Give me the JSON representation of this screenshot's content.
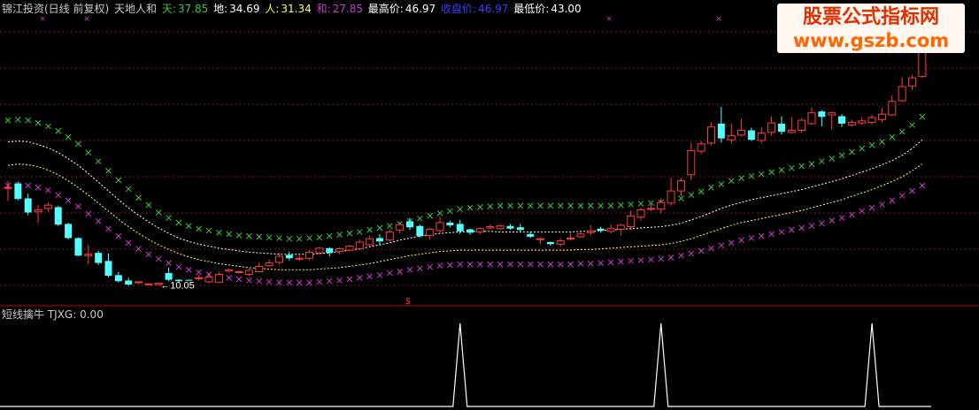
{
  "header": {
    "title": "锦江投资(日线 前复权)",
    "indicator_name": "天地人和",
    "tian_label": "天:",
    "tian_value": "37.85",
    "di_label": "地:",
    "di_value": "34.69",
    "ren_label": "人:",
    "ren_value": "31.34",
    "he_label": "和:",
    "he_value": "27.85",
    "high_label": "最高价:",
    "high_value": "46.97",
    "close_label": "收盘价:",
    "close_value": "46.97",
    "low_label": "最低价:",
    "low_value": "43.00"
  },
  "watermark": {
    "line1": "股票公式指标网",
    "line2": "www.gszb.com"
  },
  "sub_panel": {
    "name": "短线擒牛",
    "label": "TJXG:",
    "value": "0.00"
  },
  "colors": {
    "up": "#ff3c3c",
    "down": "#54ffff",
    "tian": "#3cc83c",
    "he": "#c83cc8",
    "di": "#ffffff",
    "ren": "#ffff64",
    "grid": "#7a1f1f",
    "axis": "#c00000"
  },
  "chart_data": [
    {
      "type": "candlestick",
      "ylim": [
        8,
        50
      ],
      "grid": "dotted horizontal",
      "annotations": [
        {
          "text": "←10.05",
          "index": 15,
          "value": 10.05
        }
      ],
      "candles": [
        [
          24.5,
          24.5,
          25.5,
          22.5
        ],
        [
          25.1,
          22.8,
          25.4,
          22.6
        ],
        [
          22.9,
          20.8,
          23.6,
          20.4
        ],
        [
          20.9,
          21.2,
          21.9,
          19.2
        ],
        [
          21.4,
          21.9,
          22.3,
          20.9
        ],
        [
          21.6,
          19.0,
          21.8,
          18.8
        ],
        [
          19.1,
          17.0,
          19.3,
          16.8
        ],
        [
          17.0,
          14.4,
          17.1,
          14.3
        ],
        [
          14.4,
          14.6,
          16.0,
          13.1
        ],
        [
          14.8,
          13.3,
          15.1,
          13.0
        ],
        [
          13.6,
          11.4,
          14.7,
          11.2
        ],
        [
          11.5,
          10.6,
          12.0,
          10.4
        ],
        [
          10.7,
          10.1,
          11.1,
          9.9
        ],
        [
          10.4,
          10.5,
          10.6,
          10.2
        ],
        [
          10.2,
          10.2,
          10.2,
          10.2
        ],
        [
          10.1,
          10.3,
          10.4,
          10.0
        ],
        [
          11.8,
          10.8,
          12.6,
          10.6
        ],
        [
          10.8,
          10.6,
          10.9,
          10.4
        ],
        [
          10.8,
          10.7,
          10.8,
          10.6
        ],
        [
          11.0,
          11.1,
          11.5,
          10.7
        ],
        [
          10.5,
          11.2,
          11.8,
          10.3
        ],
        [
          10.4,
          11.6,
          12.0,
          10.3
        ],
        [
          12.1,
          12.3,
          12.5,
          11.9
        ],
        [
          12.0,
          12.0,
          12.2,
          11.8
        ],
        [
          11.6,
          12.2,
          12.5,
          11.4
        ],
        [
          12.0,
          12.8,
          13.4,
          11.9
        ],
        [
          12.9,
          13.3,
          13.8,
          12.7
        ],
        [
          13.4,
          14.3,
          14.8,
          13.1
        ],
        [
          14.5,
          14.0,
          15.0,
          13.7
        ],
        [
          13.9,
          14.0,
          14.5,
          13.6
        ],
        [
          14.0,
          14.9,
          15.2,
          13.7
        ],
        [
          14.8,
          15.5,
          15.7,
          14.5
        ],
        [
          15.5,
          14.8,
          15.6,
          14.3
        ],
        [
          15.0,
          15.4,
          15.6,
          14.6
        ],
        [
          15.2,
          15.8,
          16.0,
          15.0
        ],
        [
          15.4,
          16.4,
          16.8,
          15.2
        ],
        [
          16.0,
          16.9,
          17.4,
          15.8
        ],
        [
          17.0,
          16.5,
          17.6,
          15.9
        ],
        [
          16.7,
          17.9,
          18.3,
          16.5
        ],
        [
          18.2,
          19.0,
          19.4,
          17.7
        ],
        [
          19.5,
          18.6,
          20.0,
          18.2
        ],
        [
          18.8,
          17.3,
          19.0,
          17.1
        ],
        [
          17.4,
          18.3,
          18.5,
          16.8
        ],
        [
          18.1,
          19.3,
          20.2,
          17.8
        ],
        [
          19.3,
          18.9,
          19.6,
          18.6
        ],
        [
          19.1,
          18.0,
          19.7,
          17.6
        ],
        [
          18.3,
          17.8,
          18.4,
          17.5
        ],
        [
          17.9,
          18.4,
          18.6,
          17.6
        ],
        [
          18.5,
          18.7,
          19.0,
          18.3
        ],
        [
          18.4,
          18.8,
          19.0,
          18.2
        ],
        [
          18.8,
          18.4,
          19.1,
          18.2
        ],
        [
          18.6,
          18.2,
          19.1,
          17.8
        ],
        [
          17.6,
          17.2,
          18.0,
          17.0
        ],
        [
          16.9,
          16.9,
          17.1,
          16.1
        ],
        [
          16.4,
          16.1,
          16.5,
          15.9
        ],
        [
          16.1,
          16.6,
          17.0,
          15.8
        ],
        [
          17.0,
          17.0,
          17.8,
          16.6
        ],
        [
          17.2,
          17.6,
          17.9,
          17.0
        ],
        [
          17.8,
          18.0,
          18.9,
          17.4
        ],
        [
          18.4,
          18.1,
          18.7,
          17.8
        ],
        [
          18.0,
          18.4,
          19.0,
          17.7
        ],
        [
          18.3,
          18.9,
          19.1,
          17.4
        ],
        [
          18.7,
          20.3,
          21.1,
          18.2
        ],
        [
          20.1,
          21.2,
          21.5,
          19.6
        ],
        [
          21.4,
          21.4,
          22.0,
          21.0
        ],
        [
          21.3,
          22.3,
          22.9,
          20.7
        ],
        [
          22.2,
          24.0,
          26.0,
          21.8
        ],
        [
          24.0,
          25.5,
          25.9,
          23.2
        ],
        [
          26.4,
          30.0,
          31.1,
          25.6
        ],
        [
          29.9,
          31.0,
          31.4,
          29.5
        ],
        [
          31.1,
          33.5,
          34.2,
          30.8
        ],
        [
          34.0,
          31.8,
          36.5,
          31.2
        ],
        [
          31.6,
          32.2,
          34.0,
          31.0
        ],
        [
          32.3,
          33.0,
          34.8,
          32.1
        ],
        [
          33.0,
          31.6,
          33.4,
          31.4
        ],
        [
          31.5,
          32.6,
          33.5,
          31.1
        ],
        [
          32.7,
          34.1,
          35.1,
          32.2
        ],
        [
          34.0,
          32.8,
          35.1,
          32.4
        ],
        [
          32.7,
          33.0,
          35.0,
          32.5
        ],
        [
          33.0,
          34.5,
          34.8,
          32.6
        ],
        [
          34.0,
          35.6,
          36.4,
          33.8
        ],
        [
          35.8,
          35.0,
          36.0,
          33.6
        ],
        [
          35.3,
          35.6,
          35.8,
          33.2
        ],
        [
          35.1,
          34.0,
          35.4,
          33.5
        ],
        [
          33.8,
          34.2,
          34.6,
          33.6
        ],
        [
          34.1,
          34.4,
          35.0,
          33.8
        ],
        [
          34.2,
          34.9,
          35.3,
          33.9
        ],
        [
          34.6,
          35.4,
          36.3,
          34.2
        ],
        [
          35.3,
          37.3,
          38.2,
          35.1
        ],
        [
          37.4,
          39.5,
          40.9,
          37.2
        ],
        [
          39.6,
          40.8,
          41.2,
          39.0
        ],
        [
          41.0,
          46.9,
          46.9,
          40.8
        ]
      ],
      "series": [
        {
          "name": "天",
          "marker": "x",
          "values": [
            34.5,
            34.6,
            34.5,
            34.1,
            33.6,
            32.9,
            32.0,
            31.0,
            29.7,
            28.4,
            27.0,
            25.6,
            24.3,
            23.0,
            21.9,
            20.8,
            20.0,
            19.3,
            18.8,
            18.4,
            18.1,
            17.8,
            17.6,
            17.4,
            17.3,
            17.2,
            17.1,
            17.0,
            16.9,
            16.9,
            17.0,
            17.1,
            17.3,
            17.5,
            17.7,
            17.9,
            18.2,
            18.5,
            18.8,
            19.1,
            19.5,
            19.9,
            20.3,
            20.7,
            21.0,
            21.3,
            21.5,
            21.6,
            21.7,
            21.8,
            21.8,
            21.8,
            21.8,
            21.8,
            21.8,
            21.8,
            21.8,
            21.8,
            21.8,
            21.8,
            21.8,
            21.9,
            22.0,
            22.1,
            22.2,
            22.3,
            22.6,
            22.9,
            23.4,
            23.9,
            24.5,
            25.0,
            25.5,
            25.9,
            26.2,
            26.5,
            26.8,
            27.1,
            27.4,
            27.7,
            28.0,
            28.4,
            28.8,
            29.3,
            29.8,
            30.3,
            30.8,
            31.3,
            32.0,
            32.8,
            33.8,
            35.0
          ]
        },
        {
          "name": "地",
          "style": "dotted",
          "values": [
            31.3,
            31.4,
            31.3,
            30.9,
            30.4,
            29.7,
            28.8,
            27.8,
            26.6,
            25.3,
            24.0,
            22.7,
            21.5,
            20.4,
            19.4,
            18.5,
            17.7,
            17.0,
            16.5,
            16.1,
            15.8,
            15.5,
            15.3,
            15.1,
            14.9,
            14.8,
            14.7,
            14.6,
            14.6,
            14.6,
            14.6,
            14.7,
            14.8,
            15.0,
            15.2,
            15.4,
            15.7,
            16.0,
            16.3,
            16.7,
            17.0,
            17.3,
            17.5,
            17.7,
            17.8,
            17.9,
            18.0,
            18.0,
            18.0,
            17.9,
            17.9,
            17.9,
            17.9,
            17.9,
            17.9,
            17.9,
            17.9,
            18.0,
            18.0,
            18.1,
            18.2,
            18.3,
            18.4,
            18.5,
            18.6,
            18.7,
            18.9,
            19.2,
            19.7,
            20.2,
            20.8,
            21.4,
            21.9,
            22.3,
            22.7,
            23.0,
            23.3,
            23.6,
            23.9,
            24.2,
            24.6,
            25.0,
            25.4,
            25.8,
            26.3,
            26.8,
            27.3,
            27.9,
            28.5,
            29.3,
            30.3,
            31.6
          ]
        },
        {
          "name": "人",
          "style": "dotted",
          "values": [
            27.8,
            28.0,
            27.9,
            27.6,
            27.1,
            26.4,
            25.5,
            24.5,
            23.4,
            22.2,
            21.0,
            19.8,
            18.7,
            17.7,
            16.8,
            16.0,
            15.3,
            14.7,
            14.2,
            13.8,
            13.5,
            13.2,
            13.0,
            12.8,
            12.6,
            12.5,
            12.4,
            12.3,
            12.3,
            12.3,
            12.3,
            12.4,
            12.5,
            12.6,
            12.8,
            13.0,
            13.2,
            13.5,
            13.8,
            14.1,
            14.4,
            14.6,
            14.8,
            15.0,
            15.1,
            15.2,
            15.2,
            15.2,
            15.2,
            15.2,
            15.2,
            15.2,
            15.2,
            15.2,
            15.2,
            15.2,
            15.2,
            15.3,
            15.3,
            15.4,
            15.5,
            15.6,
            15.7,
            15.8,
            15.9,
            16.0,
            16.2,
            16.5,
            16.9,
            17.4,
            17.9,
            18.4,
            18.9,
            19.3,
            19.6,
            19.9,
            20.2,
            20.5,
            20.8,
            21.1,
            21.5,
            21.9,
            22.3,
            22.7,
            23.2,
            23.7,
            24.2,
            24.8,
            25.4,
            26.1,
            27.0,
            28.0
          ]
        },
        {
          "name": "和",
          "marker": "x",
          "values": [
            24.8,
            24.9,
            24.8,
            24.5,
            24.1,
            23.4,
            22.6,
            21.7,
            20.6,
            19.5,
            18.4,
            17.3,
            16.3,
            15.4,
            14.6,
            13.9,
            13.3,
            12.7,
            12.3,
            11.9,
            11.6,
            11.3,
            11.1,
            10.9,
            10.7,
            10.6,
            10.5,
            10.4,
            10.4,
            10.4,
            10.4,
            10.5,
            10.6,
            10.7,
            10.9,
            11.1,
            11.3,
            11.5,
            11.8,
            12.0,
            12.3,
            12.5,
            12.7,
            12.9,
            13.0,
            13.1,
            13.1,
            13.1,
            13.1,
            13.1,
            13.1,
            13.1,
            13.1,
            13.1,
            13.1,
            13.1,
            13.1,
            13.2,
            13.2,
            13.3,
            13.4,
            13.5,
            13.6,
            13.7,
            13.8,
            13.9,
            14.1,
            14.4,
            14.7,
            15.1,
            15.5,
            15.9,
            16.3,
            16.7,
            17.0,
            17.3,
            17.6,
            17.9,
            18.2,
            18.5,
            18.8,
            19.2,
            19.6,
            20.0,
            20.5,
            21.0,
            21.5,
            22.0,
            22.6,
            23.3,
            24.0,
            24.8
          ]
        }
      ]
    },
    {
      "type": "line",
      "title": "短线擒牛",
      "series": [
        {
          "name": "TJXG",
          "values_spikes_at_index": [
            45,
            65,
            86
          ],
          "spike_value": 1,
          "baseline": 0
        }
      ]
    }
  ]
}
